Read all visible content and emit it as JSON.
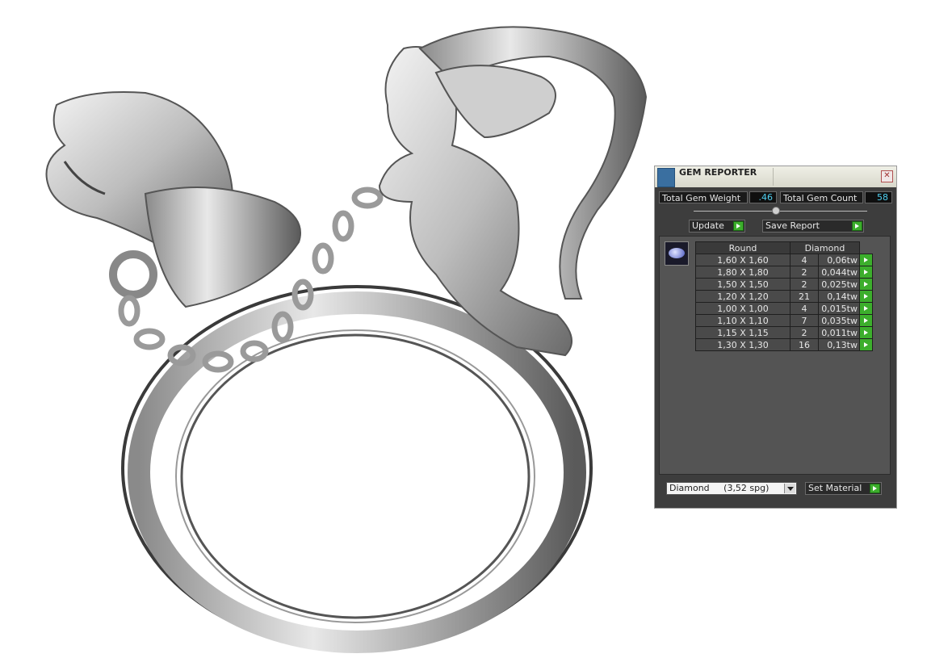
{
  "panel": {
    "title": "GEM REPORTER",
    "total_weight_label": "Total Gem Weight",
    "total_weight_value": ".46",
    "total_count_label": "Total Gem Count",
    "total_count_value": "58",
    "update_label": "Update",
    "save_report_label": "Save Report",
    "table": {
      "col_shape": "Round",
      "col_material": "Diamond",
      "rows": [
        {
          "size": "1,60 X 1,60",
          "count": "4",
          "weight": "0,06tw"
        },
        {
          "size": "1,80 X 1,80",
          "count": "2",
          "weight": "0,044tw"
        },
        {
          "size": "1,50 X 1,50",
          "count": "2",
          "weight": "0,025tw"
        },
        {
          "size": "1,20 X 1,20",
          "count": "21",
          "weight": "0,14tw"
        },
        {
          "size": "1,00 X 1,00",
          "count": "4",
          "weight": "0,015tw"
        },
        {
          "size": "1,10 X 1,10",
          "count": "7",
          "weight": "0,035tw"
        },
        {
          "size": "1,15 X 1,15",
          "count": "2",
          "weight": "0,011tw"
        },
        {
          "size": "1,30 X 1,30",
          "count": "16",
          "weight": "0,13tw"
        }
      ]
    },
    "material_select": "Diamond     (3,52 spg)",
    "set_material_label": "Set Material",
    "close_glyph": "✕"
  },
  "colors": {
    "panel_bg": "#3d3d3d",
    "value_text": "#4fd0f0",
    "go_button": "#3cae2c"
  }
}
